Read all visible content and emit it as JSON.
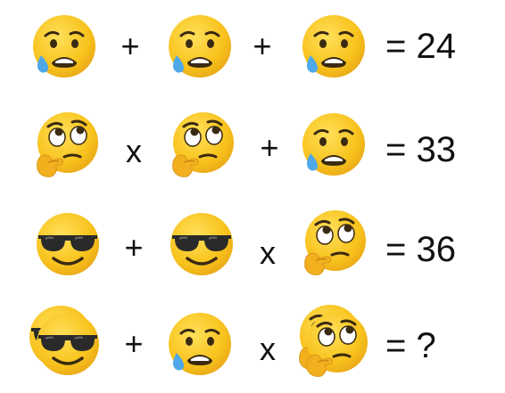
{
  "puzzle": {
    "rows": [
      {
        "terms": [
          "anxious-sweat-face",
          "anxious-sweat-face",
          "anxious-sweat-face"
        ],
        "operators": [
          "+",
          "+"
        ],
        "result": "= 24"
      },
      {
        "terms": [
          "thinking-eyeroll-face",
          "thinking-eyeroll-face",
          "anxious-sweat-face"
        ],
        "operators": [
          "x",
          "+"
        ],
        "result": "= 33"
      },
      {
        "terms": [
          "sunglasses-face",
          "sunglasses-face",
          "thinking-eyeroll-face"
        ],
        "operators": [
          "+",
          "x"
        ],
        "result": "= 36"
      },
      {
        "terms": [
          "double-sunglasses-face",
          "anxious-sweat-face",
          "double-thinking-eyeroll-face"
        ],
        "operators": [
          "+",
          "x"
        ],
        "result": "= ?"
      }
    ]
  },
  "colors": {
    "face_yellow": "#F8C21C",
    "face_shade": "#E9A818",
    "sweat_blue": "#4FA8E8",
    "dark": "#3A2A12"
  }
}
